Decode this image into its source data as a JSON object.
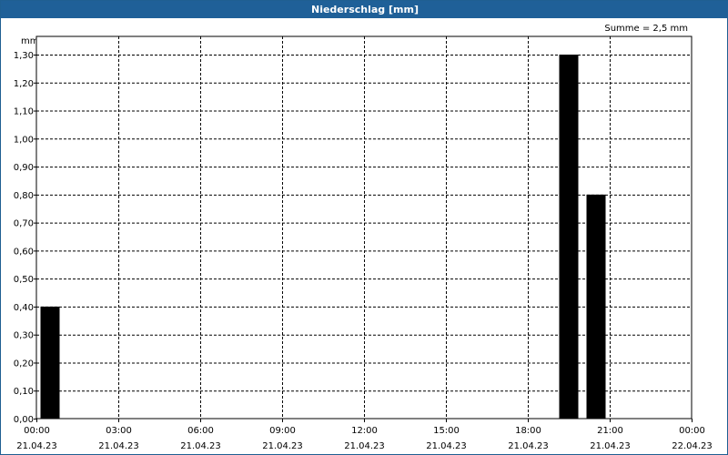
{
  "window": {
    "title": "Niederschlag [mm]"
  },
  "chart_data": {
    "type": "bar",
    "title": "Niederschlag [mm]",
    "ylabel": "mm",
    "summary": "Summe = 2,5 mm",
    "ylim": [
      0,
      1.3
    ],
    "yticks": [
      "0,00",
      "0,10",
      "0,20",
      "0,30",
      "0,40",
      "0,50",
      "0,60",
      "0,70",
      "0,80",
      "0,90",
      "1,00",
      "1,10",
      "1,20",
      "1,30"
    ],
    "xlim_hours": [
      0,
      24
    ],
    "xticks": [
      {
        "time": "00:00",
        "date": "21.04.23"
      },
      {
        "time": "03:00",
        "date": "21.04.23"
      },
      {
        "time": "06:00",
        "date": "21.04.23"
      },
      {
        "time": "09:00",
        "date": "21.04.23"
      },
      {
        "time": "12:00",
        "date": "21.04.23"
      },
      {
        "time": "15:00",
        "date": "21.04.23"
      },
      {
        "time": "18:00",
        "date": "21.04.23"
      },
      {
        "time": "21:00",
        "date": "21.04.23"
      },
      {
        "time": "00:00",
        "date": "22.04.23"
      }
    ],
    "bars": [
      {
        "start": "21.04.23 00:00",
        "end": "21.04.23 01:00",
        "value": 0.4
      },
      {
        "start": "21.04.23 19:00",
        "end": "21.04.23 20:00",
        "value": 1.3
      },
      {
        "start": "21.04.23 20:00",
        "end": "21.04.23 21:00",
        "value": 0.8
      }
    ],
    "bar_color": "#000000",
    "grid": true
  }
}
